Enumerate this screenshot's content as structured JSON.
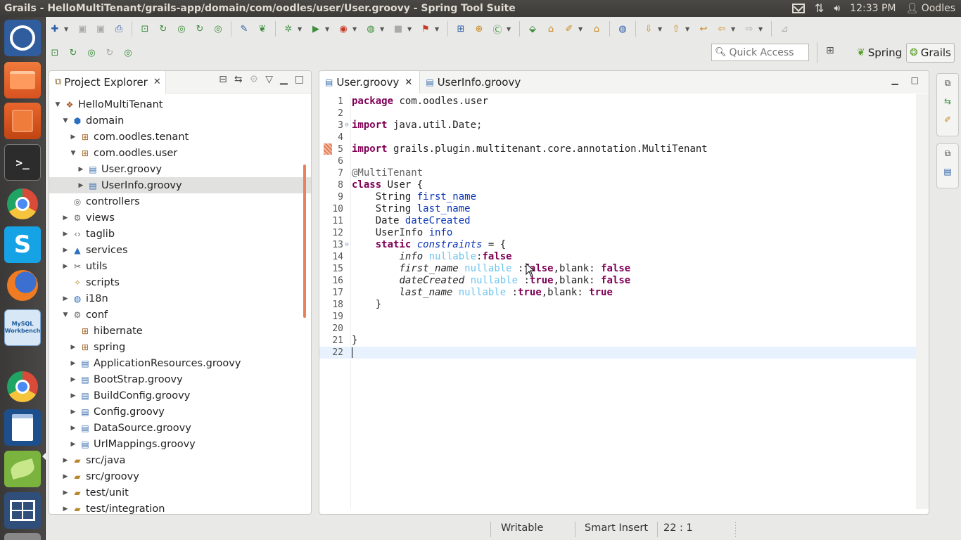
{
  "window": {
    "title": "Grails - HelloMultiTenant/grails-app/domain/com/oodles/user/User.groovy - Spring Tool Suite"
  },
  "system": {
    "time": "12:33 PM",
    "user": "Oodles"
  },
  "launcher": {
    "mysql_label_1": "MySQL",
    "mysql_label_2": "Workbench"
  },
  "toolbar": {
    "quick_access_placeholder": "Quick Access",
    "perspectives": [
      "Spring",
      "Grails"
    ]
  },
  "project_explorer": {
    "title": "Project Explorer",
    "tree": [
      {
        "label": "HelloMultiTenant",
        "level": 0,
        "expanded": true,
        "icon": "project-icon"
      },
      {
        "label": "domain",
        "level": 1,
        "expanded": true,
        "icon": "domain-icon"
      },
      {
        "label": "com.oodles.tenant",
        "level": 2,
        "expanded": false,
        "icon": "package-icon"
      },
      {
        "label": "com.oodles.user",
        "level": 2,
        "expanded": true,
        "icon": "package-icon"
      },
      {
        "label": "User.groovy",
        "level": 3,
        "expanded": false,
        "icon": "groovy-file-icon"
      },
      {
        "label": "UserInfo.groovy",
        "level": 3,
        "expanded": false,
        "icon": "groovy-file-icon",
        "selected": true
      },
      {
        "label": "controllers",
        "level": 1,
        "expanded": null,
        "icon": "controllers-icon"
      },
      {
        "label": "views",
        "level": 1,
        "expanded": false,
        "icon": "views-icon"
      },
      {
        "label": "taglib",
        "level": 1,
        "expanded": false,
        "icon": "taglib-icon"
      },
      {
        "label": "services",
        "level": 1,
        "expanded": false,
        "icon": "services-icon"
      },
      {
        "label": "utils",
        "level": 1,
        "expanded": false,
        "icon": "utils-icon"
      },
      {
        "label": "scripts",
        "level": 1,
        "expanded": null,
        "icon": "scripts-icon"
      },
      {
        "label": "i18n",
        "level": 1,
        "expanded": false,
        "icon": "globe-icon"
      },
      {
        "label": "conf",
        "level": 1,
        "expanded": true,
        "icon": "conf-icon"
      },
      {
        "label": "hibernate",
        "level": 2,
        "expanded": null,
        "icon": "package-icon"
      },
      {
        "label": "spring",
        "level": 2,
        "expanded": false,
        "icon": "package-icon"
      },
      {
        "label": "ApplicationResources.groovy",
        "level": 2,
        "expanded": false,
        "icon": "groovy-file-icon"
      },
      {
        "label": "BootStrap.groovy",
        "level": 2,
        "expanded": false,
        "icon": "groovy-file-icon"
      },
      {
        "label": "BuildConfig.groovy",
        "level": 2,
        "expanded": false,
        "icon": "groovy-file-icon"
      },
      {
        "label": "Config.groovy",
        "level": 2,
        "expanded": false,
        "icon": "groovy-file-icon"
      },
      {
        "label": "DataSource.groovy",
        "level": 2,
        "expanded": false,
        "icon": "groovy-file-icon"
      },
      {
        "label": "UrlMappings.groovy",
        "level": 2,
        "expanded": false,
        "icon": "groovy-file-icon"
      },
      {
        "label": "src/java",
        "level": 1,
        "expanded": false,
        "icon": "folder-icon"
      },
      {
        "label": "src/groovy",
        "level": 1,
        "expanded": false,
        "icon": "folder-icon"
      },
      {
        "label": "test/unit",
        "level": 1,
        "expanded": false,
        "icon": "folder-icon"
      },
      {
        "label": "test/integration",
        "level": 1,
        "expanded": false,
        "icon": "folder-icon"
      }
    ]
  },
  "editor": {
    "tabs": [
      {
        "label": "User.groovy",
        "active": true
      },
      {
        "label": "UserInfo.groovy",
        "active": false
      }
    ],
    "lines": [
      {
        "n": "1",
        "html": "<span class=\"kw\">package</span> com.oodles.user"
      },
      {
        "n": "2",
        "html": ""
      },
      {
        "n": "3",
        "html": "<span class=\"kw\">import</span> java.util.Date;",
        "fold": true
      },
      {
        "n": "4",
        "html": ""
      },
      {
        "n": "5",
        "html": "<span class=\"kw\">import</span> grails.plugin.multitenant.core.annotation.MultiTenant",
        "marker": true
      },
      {
        "n": "6",
        "html": ""
      },
      {
        "n": "7",
        "html": "<span class=\"ann\">@MultiTenant</span>"
      },
      {
        "n": "8",
        "html": "<span class=\"kw\">class</span> User {"
      },
      {
        "n": "9",
        "html": "    String <span class=\"fld\">first_name</span>"
      },
      {
        "n": "10",
        "html": "    String <span class=\"fld\">last_name</span>"
      },
      {
        "n": "11",
        "html": "    Date <span class=\"fld\">dateCreated</span>"
      },
      {
        "n": "12",
        "html": "    UserInfo <span class=\"fld\">info</span>"
      },
      {
        "n": "13",
        "html": "    <span class=\"kw\">static</span> <span class=\"fld it\">constraints</span> = {",
        "fold": true
      },
      {
        "n": "14",
        "html": "        <span class=\"it\">info</span> <span class=\"cst\">nullable</span>:<span class=\"kw\">false</span>"
      },
      {
        "n": "15",
        "html": "        <span class=\"it\">first_name</span> <span class=\"cst\">nullable</span> :<span class=\"kw\">false</span>,blank: <span class=\"kw\">false</span>"
      },
      {
        "n": "16",
        "html": "        <span class=\"it\">dateCreated</span> <span class=\"cst\">nullable</span> :<span class=\"kw\">true</span>,blank: <span class=\"kw\">false</span>"
      },
      {
        "n": "17",
        "html": "        <span class=\"it\">last_name</span> <span class=\"cst\">nullable</span> :<span class=\"kw\">true</span>,blank: <span class=\"kw\">true</span>"
      },
      {
        "n": "18",
        "html": "    }"
      },
      {
        "n": "19",
        "html": ""
      },
      {
        "n": "20",
        "html": ""
      },
      {
        "n": "21",
        "html": "}"
      },
      {
        "n": "22",
        "html": "",
        "current": true
      }
    ]
  },
  "status_bar": {
    "mode": "Writable",
    "insert": "Smart Insert",
    "position": "22 : 1"
  },
  "colors": {
    "keyword": "#7f0055",
    "field": "#0a35b5",
    "constraint": "#6ec5f0",
    "selection": "#e1e1df",
    "current_line": "#e8f2fe"
  }
}
